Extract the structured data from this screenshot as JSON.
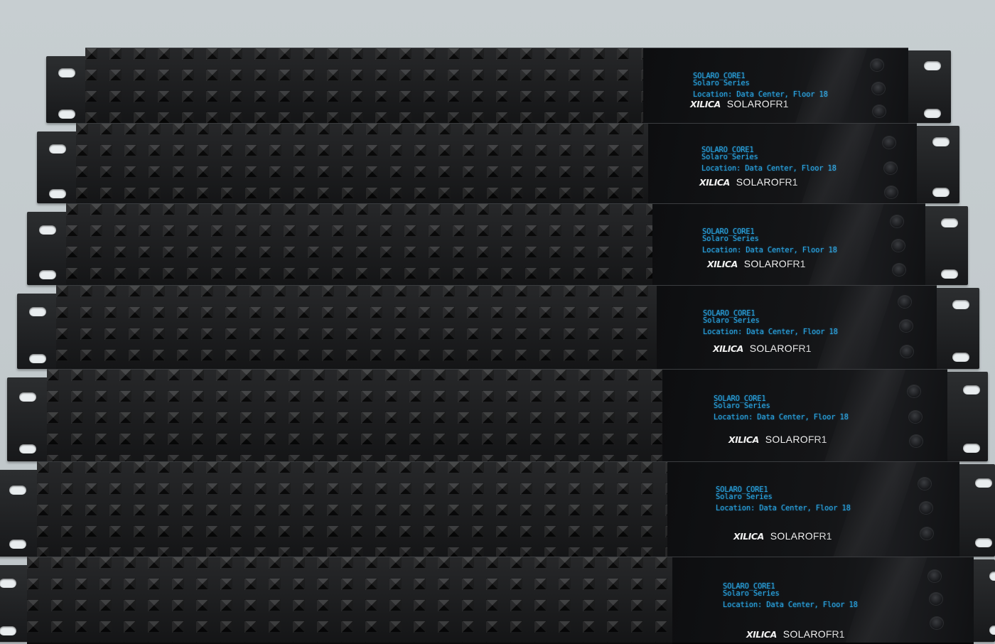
{
  "scene": {
    "background_color": "#c4cbce",
    "device_color": "#1b1c1e",
    "display_text_color": "#2aa8e6"
  },
  "units": [
    {
      "line1": "SOLARO_CORE1",
      "line2": "Solaro Series",
      "location": "Location: Data Center, Floor 18",
      "brand_logo": "XILICA",
      "model_name": "SOLARO",
      "model_suffix": "FR1"
    },
    {
      "line1": "SOLARO_CORE1",
      "line2": "Solaro Series",
      "location": "Location: Data Center, Floor 18",
      "brand_logo": "XILICA",
      "model_name": "SOLARO",
      "model_suffix": "FR1"
    },
    {
      "line1": "SOLARO_CORE1",
      "line2": "Solaro Series",
      "location": "Location: Data Center, Floor 18",
      "brand_logo": "XILICA",
      "model_name": "SOLARO",
      "model_suffix": "FR1"
    },
    {
      "line1": "SOLARO_CORE1",
      "line2": "Solaro Series",
      "location": "Location: Data Center, Floor 18",
      "brand_logo": "XILICA",
      "model_name": "SOLARO",
      "model_suffix": "FR1"
    },
    {
      "line1": "SOLARO_CORE1",
      "line2": "Solaro Series",
      "location": "Location: Data Center, Floor 18",
      "brand_logo": "XILICA",
      "model_name": "SOLARO",
      "model_suffix": "FR1"
    },
    {
      "line1": "SOLARO_CORE1",
      "line2": "Solaro Series",
      "location": "Location: Data Center, Floor 18",
      "brand_logo": "XILICA",
      "model_name": "SOLARO",
      "model_suffix": "FR1"
    },
    {
      "line1": "SOLARO_CORE1",
      "line2": "Solaro Series",
      "location": "Location: Data Center, Floor 18",
      "brand_logo": "XILICA",
      "model_name": "SOLARO",
      "model_suffix": "FR1"
    }
  ]
}
